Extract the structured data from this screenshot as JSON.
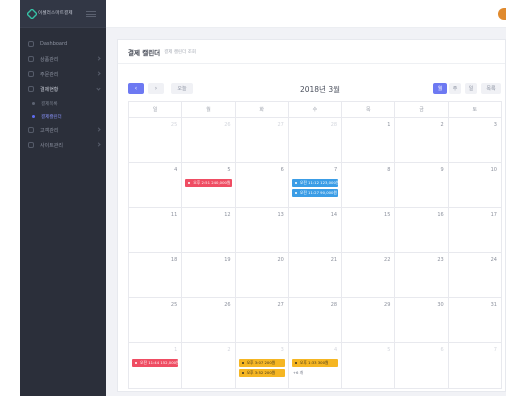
{
  "brand": {
    "name": "이셀러스마트결제",
    "logo_icon": "diamond-logo-icon"
  },
  "sidebar": {
    "items": [
      {
        "label": "Dashboard",
        "icon": "dashboard-icon"
      },
      {
        "label": "상품관리",
        "icon": "box-icon"
      },
      {
        "label": "주문관리",
        "icon": "cart-icon"
      },
      {
        "label": "결제현황",
        "icon": "card-icon",
        "open": true
      },
      {
        "label": "결제목록",
        "sub": true
      },
      {
        "label": "결제캘린더",
        "sub": true,
        "active": true
      },
      {
        "label": "고객관리",
        "icon": "user-icon"
      },
      {
        "label": "사이트관리",
        "icon": "gear-icon"
      }
    ]
  },
  "page": {
    "title": "결제 캘린더",
    "subtitle": "결제 캘린더 조회"
  },
  "calendar": {
    "prev_label": "‹",
    "next_label": "›",
    "today_label": "오늘",
    "title": "2018년 3월",
    "views": [
      "월",
      "주",
      "일",
      "목록"
    ],
    "active_view": "월",
    "weekdays": [
      "일",
      "월",
      "화",
      "수",
      "목",
      "금",
      "토"
    ],
    "weeks": [
      [
        {
          "d": "25",
          "o": true
        },
        {
          "d": "26",
          "o": true
        },
        {
          "d": "27",
          "o": true
        },
        {
          "d": "28",
          "o": true
        },
        {
          "d": "1"
        },
        {
          "d": "2"
        },
        {
          "d": "3"
        }
      ],
      [
        {
          "d": "4"
        },
        {
          "d": "5"
        },
        {
          "d": "6"
        },
        {
          "d": "7"
        },
        {
          "d": "8"
        },
        {
          "d": "9"
        },
        {
          "d": "10"
        }
      ],
      [
        {
          "d": "11"
        },
        {
          "d": "12"
        },
        {
          "d": "13"
        },
        {
          "d": "14"
        },
        {
          "d": "15"
        },
        {
          "d": "16"
        },
        {
          "d": "17"
        }
      ],
      [
        {
          "d": "18"
        },
        {
          "d": "19"
        },
        {
          "d": "20"
        },
        {
          "d": "21"
        },
        {
          "d": "22"
        },
        {
          "d": "23"
        },
        {
          "d": "24"
        }
      ],
      [
        {
          "d": "25"
        },
        {
          "d": "26"
        },
        {
          "d": "27"
        },
        {
          "d": "28"
        },
        {
          "d": "29"
        },
        {
          "d": "30"
        },
        {
          "d": "31"
        }
      ],
      [
        {
          "d": "1",
          "o": true
        },
        {
          "d": "2",
          "o": true
        },
        {
          "d": "3",
          "o": true
        },
        {
          "d": "4",
          "o": true
        },
        {
          "d": "5",
          "o": true
        },
        {
          "d": "6",
          "o": true
        },
        {
          "d": "7",
          "o": true
        }
      ]
    ],
    "events": [
      {
        "week": 1,
        "day": 1,
        "slot": 0,
        "color": "red",
        "label": "오후 2:51 240,000원"
      },
      {
        "week": 1,
        "day": 3,
        "slot": 0,
        "color": "blue",
        "label": "오전 11:12 123,000원"
      },
      {
        "week": 1,
        "day": 3,
        "slot": 1,
        "color": "blue",
        "label": "오전 11:27 90,000원"
      },
      {
        "week": 5,
        "day": 0,
        "slot": 0,
        "color": "red",
        "label": "오전 11:44 152,000원"
      },
      {
        "week": 5,
        "day": 2,
        "slot": 0,
        "color": "yellow",
        "label": "오후 3:07 200원"
      },
      {
        "week": 5,
        "day": 2,
        "slot": 1,
        "color": "yellow",
        "label": "오후 3:52 200원"
      },
      {
        "week": 5,
        "day": 3,
        "slot": 0,
        "color": "yellow",
        "label": "오후 1:33 300원"
      }
    ],
    "more": [
      {
        "week": 5,
        "day": 3,
        "label": "+6 개"
      }
    ]
  },
  "colors": {
    "accent": "#6d79f2",
    "red": "#ef4d63",
    "blue": "#3b9de6",
    "yellow": "#f5b623",
    "sidebar": "#2b2f3a"
  }
}
